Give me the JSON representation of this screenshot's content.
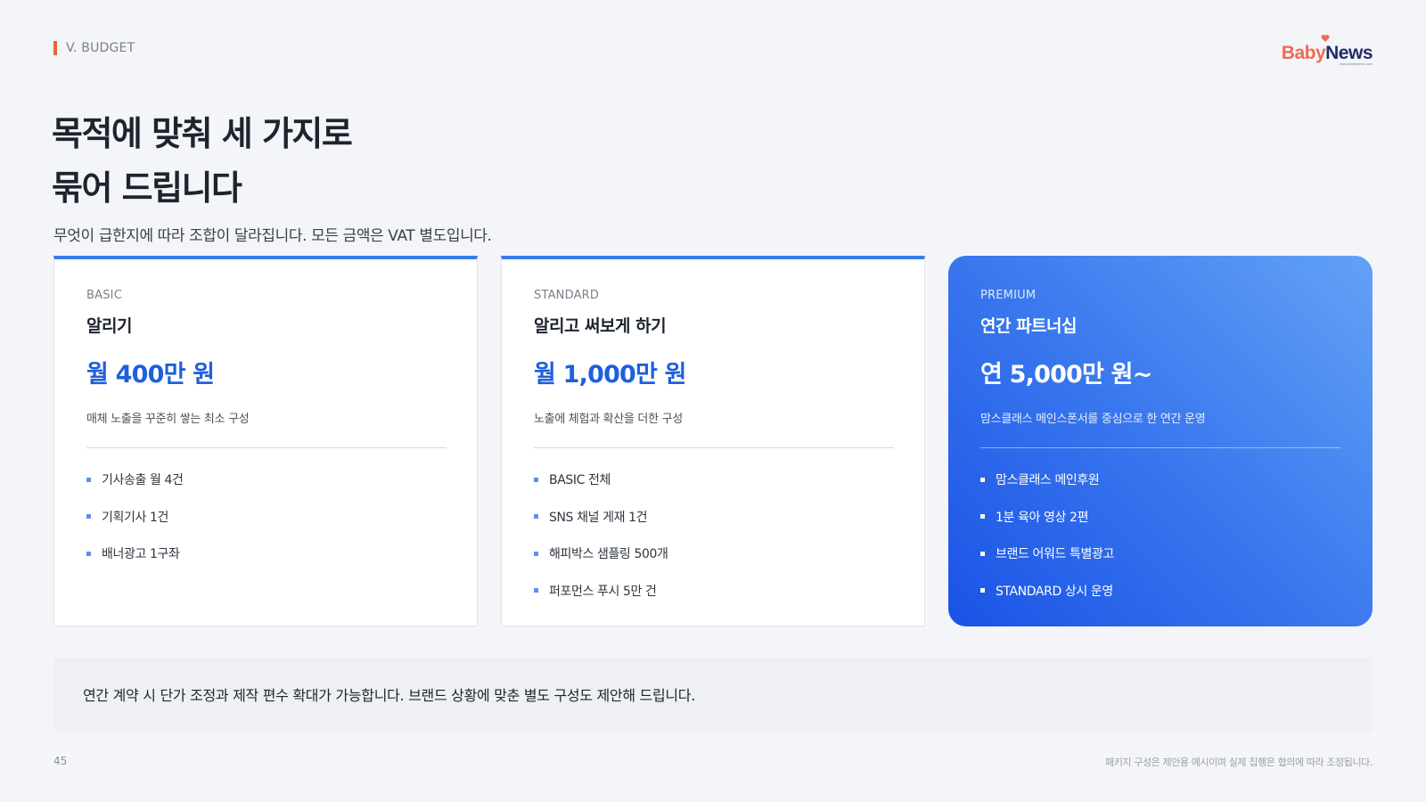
{
  "header": {
    "section": "V. BUDGET",
    "logo": {
      "part1": "Baby",
      "part2": "News",
      "tagline": "www.ibabynews.com"
    }
  },
  "headline": {
    "line1": "목적에 맞춰 세 가지로",
    "line2": "묶어 드립니다"
  },
  "subline": "무엇이 급한지에 따라 조합이 달라집니다. 모든 금액은 VAT 별도입니다.",
  "plans": [
    {
      "tier": "BASIC",
      "name": "알리기",
      "price": "월 400만 원",
      "desc": "매체 노출을 꾸준히 쌓는 최소 구성",
      "items": [
        "기사송출 월 4건",
        "기획기사 1건",
        "배너광고 1구좌"
      ]
    },
    {
      "tier": "STANDARD",
      "name": "알리고 써보게 하기",
      "price": "월 1,000만 원",
      "desc": "노출에 체험과 확산을 더한 구성",
      "items": [
        "BASIC 전체",
        "SNS 채널 게재 1건",
        "해피박스 샘플링 500개",
        "퍼포먼스 푸시 5만 건"
      ]
    },
    {
      "tier": "PREMIUM",
      "name": "연간 파트너십",
      "price": "연 5,000만 원~",
      "desc": "맘스클래스 메인스폰서를 중심으로 한 연간 운영",
      "items": [
        "맘스클래스 메인후원",
        "1분 육아 영상 2편",
        "브랜드 어워드 특별광고",
        "STANDARD 상시 운영"
      ]
    }
  ],
  "note": "연간 계약 시 단가 조정과 제작 편수 확대가 가능합니다. 브랜드 상황에 맞춘 별도 구성도 제안해 드립니다.",
  "footer": {
    "page": "45",
    "footnote": "패키지 구성은 제안용 예시이며 실제 집행은 협의에 따라 조정됩니다."
  },
  "colors": {
    "accent": "#3b7be6",
    "price_blue": "#1e5fdc",
    "section_bar": "#e8643a",
    "premium_gradient_start": "#63a2f6",
    "premium_gradient_end": "#1a53e6"
  }
}
